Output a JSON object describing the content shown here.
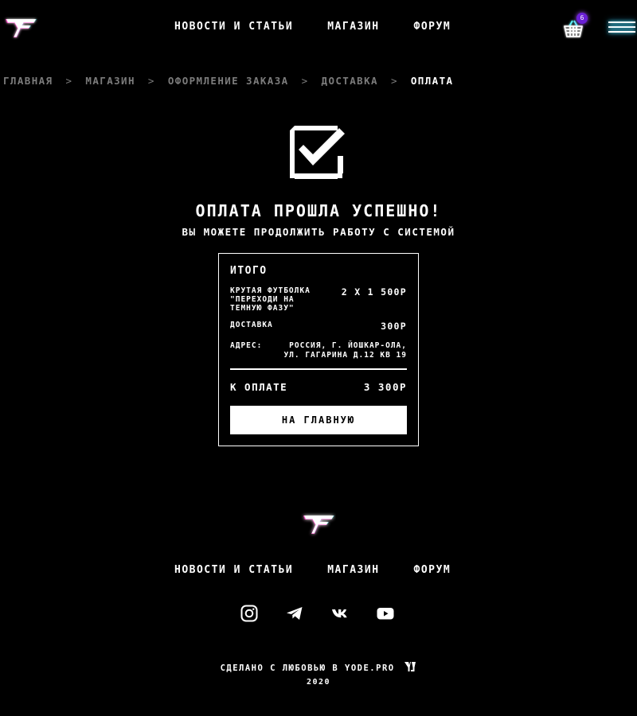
{
  "header": {
    "nav": [
      "Новости и статьи",
      "Магазин",
      "Форум"
    ],
    "cart_count": "6"
  },
  "breadcrumbs": [
    "Главная",
    "Магазин",
    "Оформление заказа",
    "Доставка",
    "Оплата"
  ],
  "success": {
    "title": "Оплата прошла успешно!",
    "subtitle": "Вы можете продолжить работу с системой"
  },
  "receipt": {
    "title": "Итого",
    "item_name": "Крутая футболка \"Переходи на темную фазу\"",
    "item_price": "2 x 1 500р",
    "delivery_label": "Доставка",
    "delivery_price": "300р",
    "address_label": "Адрес:",
    "address_line1": "Россия, г. Йошкар-Ола,",
    "address_line2": "ул. Гагарина д.12 кв 19",
    "total_label": "К оплате",
    "total_value": "3 300р",
    "button_label": "На главную"
  },
  "footer": {
    "nav": [
      "Новости и статьи",
      "Магазин",
      "Форум"
    ],
    "socials": [
      "instagram-icon",
      "telegram-icon",
      "vk-icon",
      "youtube-icon"
    ],
    "credit": "Сделано с любовью в yode.pro",
    "year": "2020"
  },
  "colors": {
    "background": "#000000",
    "text": "#ffffff",
    "muted": "#7c7c7c",
    "glow_pink": "#ff3cc8",
    "glow_cyan": "#3cf0ff",
    "badge": "#6a1fd6"
  }
}
